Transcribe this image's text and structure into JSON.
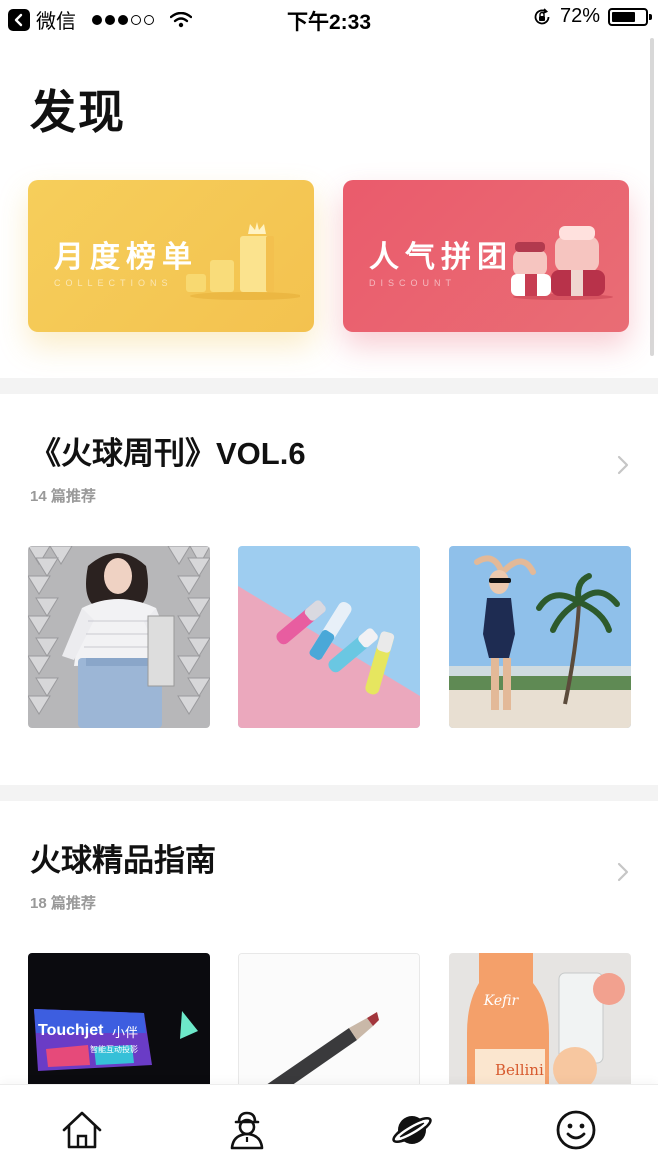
{
  "status_bar": {
    "carrier": "微信",
    "time": "下午2:33",
    "battery": "72%",
    "battery_level": 0.72
  },
  "page": {
    "title": "发现"
  },
  "banners": [
    {
      "title": "月度榜单",
      "subtitle": "COLLECTIONS",
      "color": "#f5c95a"
    },
    {
      "title": "人气拼团",
      "subtitle": "DISCOUNT",
      "color": "#ea5f6e"
    }
  ],
  "sections": [
    {
      "title": "《火球周刊》VOL.6",
      "count": "14 篇推荐"
    },
    {
      "title": "火球精品指南",
      "count": "18 篇推荐"
    }
  ],
  "thumb_text": {
    "touchjet": "Touchjet",
    "touchjet_cn": "小伴",
    "touchjet_sub": "智能互动投影",
    "bottle_brand": "Kefir",
    "bottle_label": "Bellini"
  },
  "tabbar": {
    "items": [
      {
        "icon": "home-icon"
      },
      {
        "icon": "person-icon"
      },
      {
        "icon": "planet-icon",
        "active": true
      },
      {
        "icon": "smiley-icon"
      }
    ]
  }
}
